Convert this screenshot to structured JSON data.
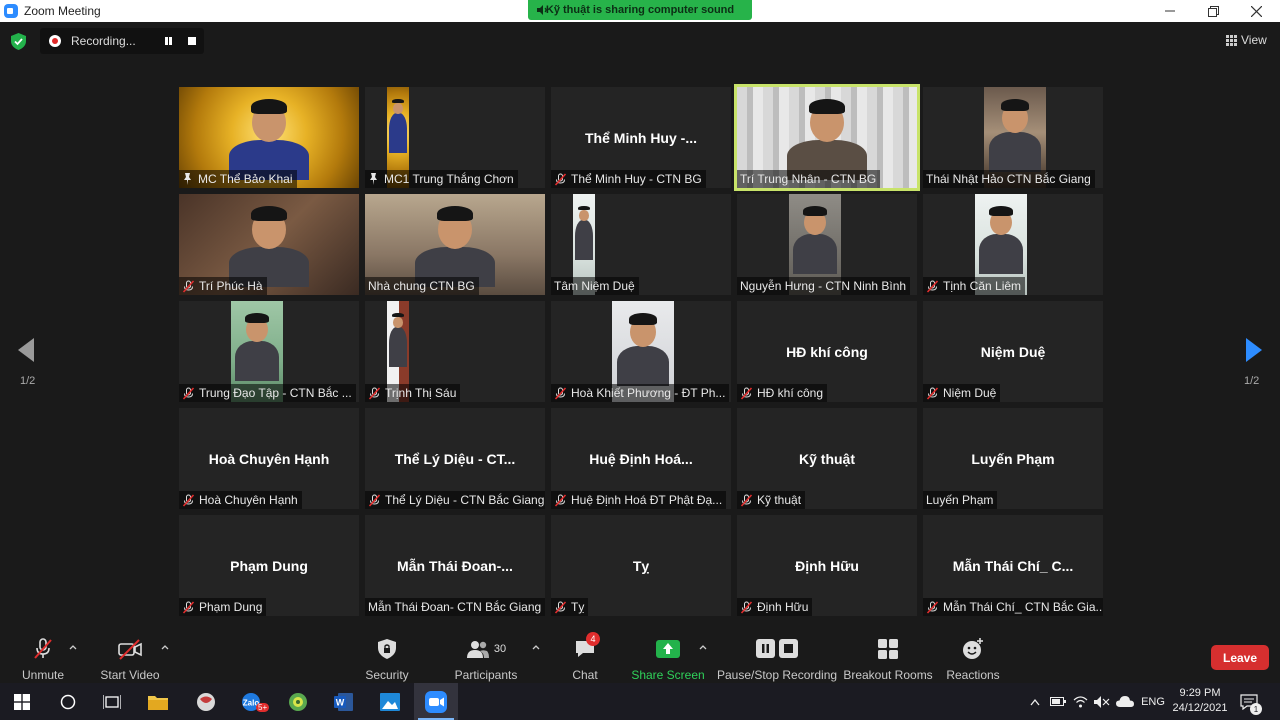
{
  "window": {
    "title": "Zoom Meeting",
    "share_banner": "Kỹ thuật is sharing computer sound"
  },
  "recording": {
    "label": "Recording..."
  },
  "view_button": {
    "label": "View"
  },
  "pagination": {
    "left": "1/2",
    "right": "1/2"
  },
  "tiles": [
    {
      "big": "",
      "tag": "MC Thể Bảo Khai",
      "status": "pinned",
      "video": "gold"
    },
    {
      "big": "",
      "tag": "MC1 Trung Thắng Chơn",
      "status": "pinned",
      "video": "gold"
    },
    {
      "big": "Thể Minh Huy -...",
      "tag": "Thể Minh Huy - CTN BG",
      "status": "muted",
      "video": "none"
    },
    {
      "big": "",
      "tag": "Trí Trung Nhân - CTN BG",
      "status": "none",
      "video": "curtain"
    },
    {
      "big": "",
      "tag": "Thái Nhật Hảo CTN Bắc Giang",
      "status": "none",
      "video": "room"
    },
    {
      "big": "",
      "tag": "Trí Phúc Hà",
      "status": "muted",
      "video": "wood"
    },
    {
      "big": "",
      "tag": "Nhà chung CTN BG",
      "status": "none",
      "video": "group"
    },
    {
      "big": "",
      "tag": "Tâm Niệm Duệ",
      "status": "none",
      "video": "bright"
    },
    {
      "big": "",
      "tag": "Nguyễn Hưng - CTN Ninh Bình",
      "status": "none",
      "video": "dim"
    },
    {
      "big": "",
      "tag": "Tịnh Căn Liêm",
      "status": "muted",
      "video": "bright"
    },
    {
      "big": "",
      "tag": "Trung Đạo Tập - CTN Bắc ...",
      "status": "muted",
      "video": "green"
    },
    {
      "big": "",
      "tag": "Trịnh Thị Sáu",
      "status": "muted",
      "video": "door"
    },
    {
      "big": "",
      "tag": "Hoà Khiết Phương - ĐT Ph...",
      "status": "muted",
      "video": "shelf"
    },
    {
      "big": "HĐ khí công",
      "tag": "HĐ khí công",
      "status": "muted",
      "video": "none"
    },
    {
      "big": "Niệm Duệ",
      "tag": "Niệm Duệ",
      "status": "muted",
      "video": "none"
    },
    {
      "big": "Hoà Chuyên Hạnh",
      "tag": "Hoà Chuyên Hạnh",
      "status": "muted",
      "video": "none"
    },
    {
      "big": "Thể Lý Diệu - CT...",
      "tag": "Thể Lý Diệu - CTN Bắc Giang",
      "status": "muted",
      "video": "none"
    },
    {
      "big": "Huệ Định Hoá...",
      "tag": "Huệ Định Hoá  ĐT Phật Đạ...",
      "status": "muted",
      "video": "none"
    },
    {
      "big": "Kỹ thuật",
      "tag": "Kỹ thuật",
      "status": "muted",
      "video": "none"
    },
    {
      "big": "Luyến Phạm",
      "tag": "Luyến Phạm",
      "status": "none",
      "video": "none"
    },
    {
      "big": "Phạm Dung",
      "tag": "Phạm Dung",
      "status": "muted",
      "video": "none"
    },
    {
      "big": "Mẫn Thái Đoan-...",
      "tag": "Mẫn Thái Đoan- CTN Bắc Giang",
      "status": "none",
      "video": "none"
    },
    {
      "big": "Tỵ",
      "tag": "Tỵ",
      "status": "muted",
      "video": "none"
    },
    {
      "big": "Định Hữu",
      "tag": "Định Hữu",
      "status": "muted",
      "video": "none"
    },
    {
      "big": "Mẫn Thái Chí_ C...",
      "tag": "Mẫn Thái Chí_ CTN Bắc Gia...",
      "status": "muted",
      "video": "none"
    }
  ],
  "toolbar": {
    "unmute": "Unmute",
    "start_video": "Start Video",
    "security": "Security",
    "participants": "Participants",
    "participants_count": "30",
    "chat": "Chat",
    "chat_badge": "4",
    "share_screen": "Share Screen",
    "pause_stop_recording": "Pause/Stop Recording",
    "breakout_rooms": "Breakout Rooms",
    "reactions": "Reactions",
    "leave": "Leave"
  },
  "taskbar": {
    "language": "ENG",
    "time": "9:29 PM",
    "date": "24/12/2021",
    "notification_count": "1",
    "zalo_badge": "5+"
  },
  "colors": {
    "accent_blue": "#2d8cff",
    "share_green": "#27b34a",
    "active_speaker": "#c8e36a",
    "leave_red": "#d62f2f",
    "mute_red": "#e02d2d"
  }
}
